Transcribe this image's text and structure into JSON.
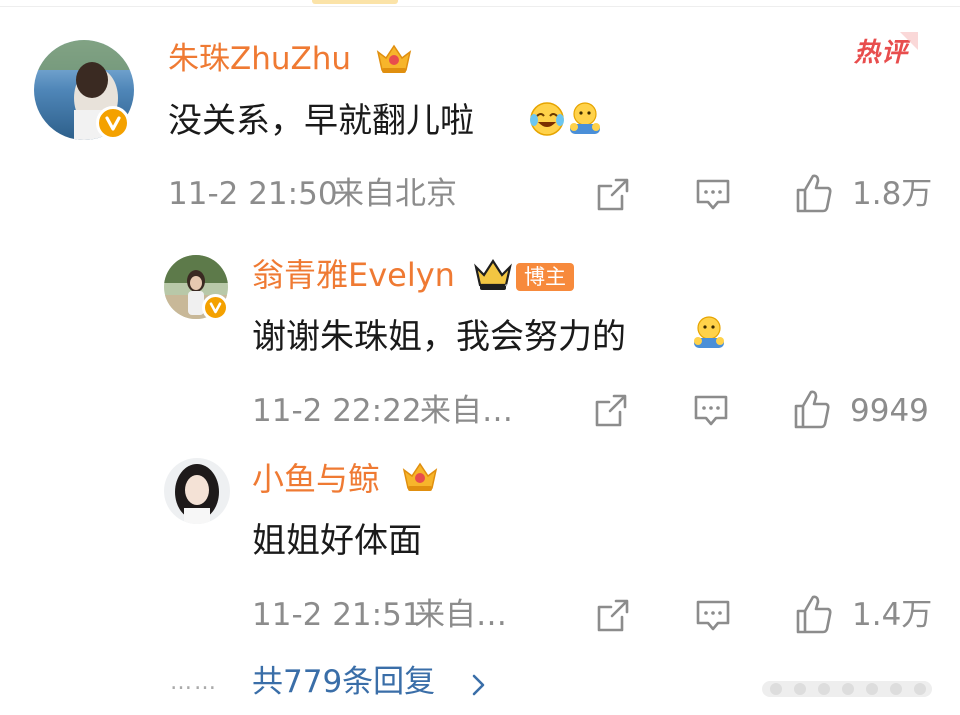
{
  "comment": {
    "username": "朱珠ZhuZhu",
    "text": "没关系，早就翻儿啦",
    "emoji": [
      "laugh-cry-emoji",
      "hug-emoji"
    ],
    "time": "11-2 21:50",
    "location": "来自北京",
    "likes": "1.8万",
    "hot_label": "热评"
  },
  "replies": [
    {
      "username": "翁青雅Evelyn",
      "tag": "博主",
      "text": "谢谢朱珠姐，我会努力的",
      "emoji": [
        "hug-emoji"
      ],
      "time": "11-2 22:22",
      "location": "来自…",
      "likes": "9949"
    },
    {
      "username": "小鱼与鲸",
      "text": "姐姐好体面",
      "time": "11-2 21:51",
      "location": "来自…",
      "likes": "1.4万"
    }
  ],
  "footer": {
    "dots": "……",
    "more_replies": "共779条回复"
  },
  "colors": {
    "username": "#ef7a33",
    "link": "#3a6ea8",
    "meta": "#8c8c8c",
    "verified": "#f4a100",
    "hot": "#e84d4d"
  }
}
